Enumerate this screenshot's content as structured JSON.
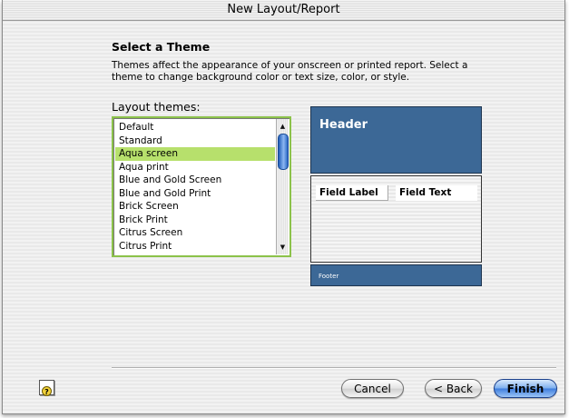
{
  "window": {
    "title": "New Layout/Report"
  },
  "heading": "Select a Theme",
  "description": "Themes affect the appearance of your onscreen or printed report.  Select a theme to change background color or text size, color, or style.",
  "themes": {
    "label": "Layout themes:",
    "selected": "Aqua screen",
    "items": [
      "Default",
      "Standard",
      "Aqua screen",
      "Aqua print",
      "Blue and Gold Screen",
      "Blue and Gold Print",
      "Brick Screen",
      "Brick Print",
      "Citrus Screen",
      "Citrus Print"
    ]
  },
  "preview": {
    "header": "Header",
    "field_label": "Field Label",
    "field_text": "Field Text",
    "footer": "Footer",
    "colors": {
      "band": "#3c6896",
      "selection": "#b7e06c"
    }
  },
  "buttons": {
    "cancel": "Cancel",
    "back": "< Back",
    "finish": "Finish"
  },
  "help_icon": {
    "icon": "help-icon",
    "glyph": "?"
  }
}
